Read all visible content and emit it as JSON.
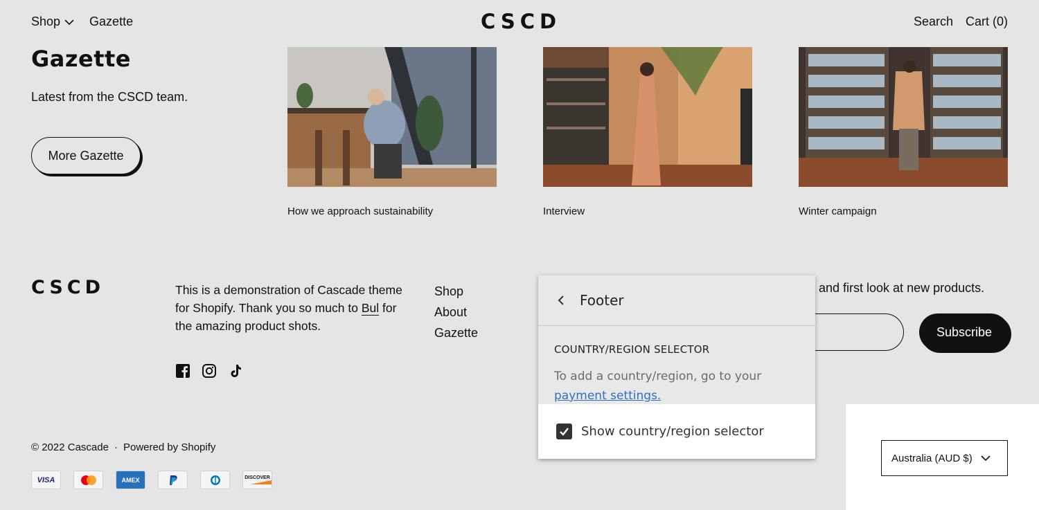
{
  "header": {
    "nav_left": [
      {
        "label": "Shop"
      },
      {
        "label": "Gazette"
      }
    ],
    "logo": "CSCD",
    "search": "Search",
    "cart": "Cart (0)"
  },
  "gazette": {
    "title": "Gazette",
    "subtitle": "Latest from the CSCD team.",
    "button": "More Gazette",
    "articles": [
      {
        "caption": "How we approach sustainability"
      },
      {
        "caption": "Interview"
      },
      {
        "caption": "Winter campaign"
      }
    ]
  },
  "footer": {
    "logo": "CSCD",
    "about_before": "This is a demonstration of Cascade theme for Shopify. Thank you so much to ",
    "about_link": "Bul",
    "about_after": " for the amazing product shots.",
    "social_icons": [
      "facebook-icon",
      "instagram-icon",
      "tiktok-icon"
    ],
    "links": [
      "Shop",
      "About",
      "Gazette"
    ],
    "newsletter_text": "and first look at new products.",
    "subscribe": "Subscribe",
    "copyright": "© 2022 Cascade",
    "separator": "·",
    "powered": "Powered by Shopify",
    "payments": [
      "VISA",
      "Mastercard",
      "AMEX",
      "PayPal",
      "Diners Club",
      "DISCOVER"
    ],
    "country_select": "Australia (AUD $)"
  },
  "editor_popup": {
    "title": "Footer",
    "section": "COUNTRY/REGION SELECTOR",
    "info": "To add a country/region, go to your",
    "info_link": "payment settings.",
    "checkbox_label": "Show country/region selector",
    "checkbox_checked": true
  }
}
